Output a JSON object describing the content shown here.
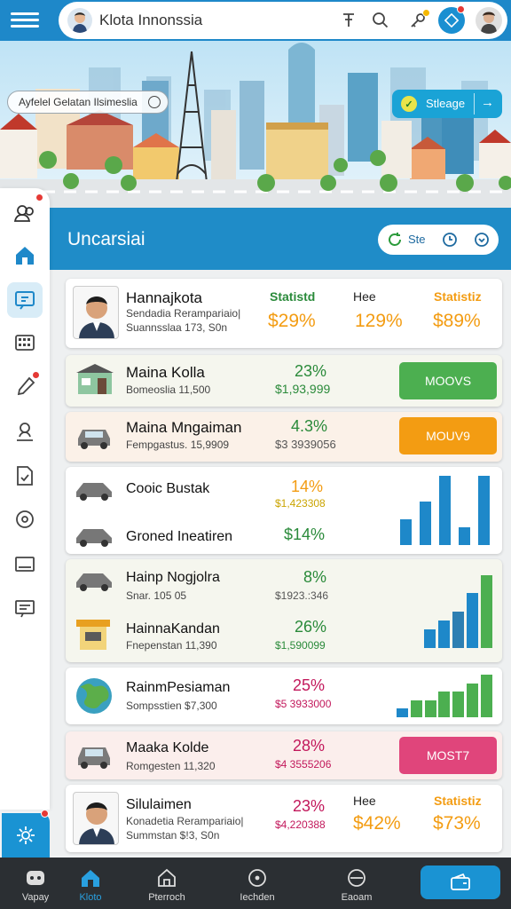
{
  "header": {
    "title": "Klota Innonssia"
  },
  "banner": {
    "location_chip": "Ayfelel Gelatan Ilsimeslia",
    "status_chip": "Stleage"
  },
  "section": {
    "title": "Uncarsiai",
    "pill_label": "Ste"
  },
  "cards": [
    {
      "name": "Hannajkota",
      "sub1": "Sendadia Rerampariaio|",
      "sub2": "Suannsslaa 173, S0n",
      "col1_label": "Statistd",
      "col1_value": "$29%",
      "col2_label": "Hee",
      "col2_value": "129%",
      "col3_label": "Statistiz",
      "col3_value": "$89%"
    },
    {
      "name": "Maina Kolla",
      "sub": "Bomeoslia 11,500",
      "pct": "23%",
      "amount": "$1,93,999",
      "button": "MOOVS"
    },
    {
      "name": "Maina Mngaiman",
      "sub": "Fempgastus. 15,9909",
      "pct": "4.3%",
      "amount": "$3 3939056",
      "button": "MOUV9"
    },
    {
      "name": "Cooic Bustak",
      "pct": "14%",
      "amount": "$1,423308",
      "name2": "Groned Ineatiren",
      "pct2": "$14%"
    },
    {
      "name": "Hainp Nogjolra",
      "sub": "Snar. 105 05",
      "pct": "8%",
      "amount": "$1923.:346",
      "name2": "HainnaKandan",
      "sub2": "Fnepenstan 11,390",
      "pct2": "26%",
      "amount2": "$1,590099"
    },
    {
      "name": "RainmPesiaman",
      "sub": "Sompsstien $7,300",
      "pct": "25%",
      "amount": "$5 3933000"
    },
    {
      "name": "Maaka Kolde",
      "sub": "Romgesten 11,320",
      "pct": "28%",
      "amount": "$4 3555206",
      "button": "MOST7"
    },
    {
      "name": "Silulaimen",
      "sub1": "Konadetia Rerampariaio|",
      "sub2": "Summstan $!3, S0n",
      "col1_value": "23%",
      "col1_amount": "$4,220388",
      "col2_label": "Hee",
      "col2_value": "$42%",
      "col3_label": "Statistiz",
      "col3_value": "$73%"
    }
  ],
  "charts": [
    {
      "values": [
        3,
        5,
        8,
        2,
        8
      ],
      "colors": [
        "#1e88c9",
        "#1e88c9",
        "#1e88c9",
        "#1e88c9",
        "#1e88c9"
      ]
    },
    {
      "values": [
        2,
        3,
        4,
        6,
        8
      ],
      "colors": [
        "#1e88c9",
        "#1e88c9",
        "#2d7fb2",
        "#1e88c9",
        "#4caf50"
      ]
    },
    {
      "values": [
        1,
        2,
        2,
        3,
        3,
        4,
        5
      ],
      "colors": [
        "#1e88c9",
        "#4caf50",
        "#4caf50",
        "#4caf50",
        "#4caf50",
        "#4caf50",
        "#4caf50"
      ]
    }
  ],
  "bottom_nav": [
    {
      "label": "Vapay",
      "icon": "chat-icon"
    },
    {
      "label": "Kloto",
      "icon": "home-icon"
    },
    {
      "label": "Pterroch",
      "icon": "house-icon"
    },
    {
      "label": "Iechden",
      "icon": "circle-icon"
    },
    {
      "label": "Eaoam",
      "icon": "minus-circle-icon"
    }
  ],
  "colors": {
    "primary": "#1e88c9",
    "green": "#4caf50",
    "orange": "#f39c12",
    "pink": "#e0457b",
    "crimson": "#c2185b"
  }
}
